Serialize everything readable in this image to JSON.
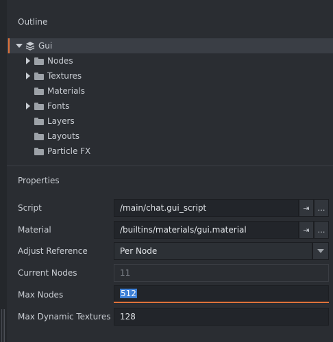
{
  "outline": {
    "title": "Outline",
    "items": [
      {
        "label": "Gui",
        "expander": "down",
        "icon": "layers-icon",
        "selected": true
      },
      {
        "label": "Nodes",
        "expander": "right",
        "icon": "folder-icon"
      },
      {
        "label": "Textures",
        "expander": "right",
        "icon": "folder-icon"
      },
      {
        "label": "Materials",
        "expander": "none",
        "icon": "folder-icon"
      },
      {
        "label": "Fonts",
        "expander": "right",
        "icon": "folder-icon"
      },
      {
        "label": "Layers",
        "expander": "none",
        "icon": "folder-icon"
      },
      {
        "label": "Layouts",
        "expander": "none",
        "icon": "folder-icon"
      },
      {
        "label": "Particle FX",
        "expander": "none",
        "icon": "folder-icon"
      }
    ]
  },
  "properties": {
    "title": "Properties",
    "script": {
      "label": "Script",
      "value": "/main/chat.gui_script",
      "goto_icon": "⇥",
      "browse_label": "…"
    },
    "material": {
      "label": "Material",
      "value": "/builtins/materials/gui.material",
      "goto_icon": "⇥",
      "browse_label": "…"
    },
    "adjust_reference": {
      "label": "Adjust Reference",
      "value": "Per Node"
    },
    "current_nodes": {
      "label": "Current Nodes",
      "value": "11"
    },
    "max_nodes": {
      "label": "Max Nodes",
      "value": "512"
    },
    "max_dynamic_textures": {
      "label": "Max Dynamic Textures",
      "value": "128"
    }
  },
  "colors": {
    "accent": "#e0733b",
    "selection": "#3d7fd6",
    "background": "#2a2d32"
  }
}
